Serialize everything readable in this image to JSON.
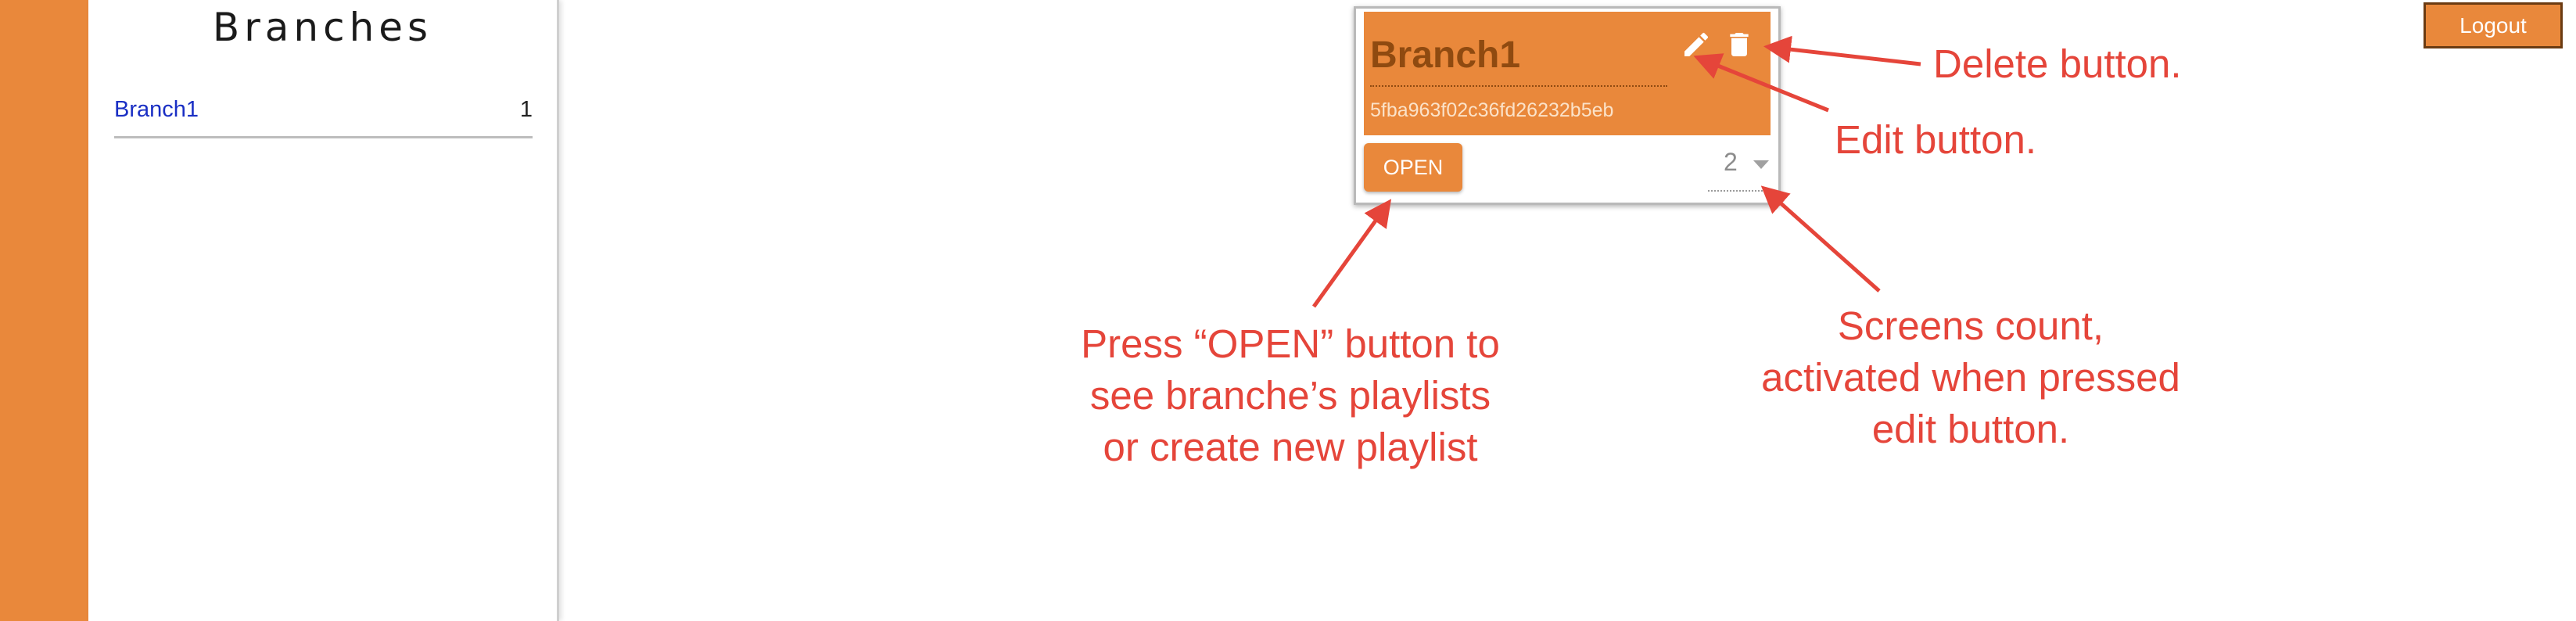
{
  "sidebar": {
    "title": "Branches",
    "items": [
      {
        "label": "Branch1",
        "count": "1"
      }
    ]
  },
  "card": {
    "title": "Branch1",
    "id": "5fba963f02c36fd26232b5eb",
    "open_label": "OPEN",
    "screens_count": "2",
    "edit_icon": "pencil-icon",
    "delete_icon": "trash-icon"
  },
  "header": {
    "logout_label": "Logout"
  },
  "annotations": {
    "delete": "Delete button.",
    "edit": "Edit button.",
    "open_lines": [
      "Press “OPEN” button to",
      "see branche’s playlists",
      "or create new playlist"
    ],
    "screens_lines": [
      "Screens count,",
      "activated when pressed",
      "edit button."
    ]
  },
  "colors": {
    "accent": "#e9883b",
    "annotation": "#e5453a",
    "link": "#1a2fc4"
  }
}
